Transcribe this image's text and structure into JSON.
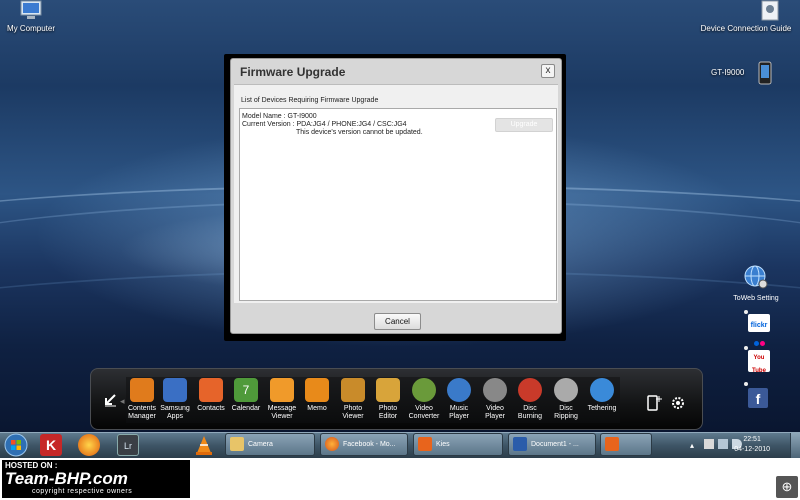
{
  "desktop": {
    "my_computer": "My Computer",
    "device_connection_guide": "Device Connection Guide",
    "device_model": "GT-I9000"
  },
  "dialog": {
    "title": "Firmware Upgrade",
    "close": "x",
    "list_caption": "List of Devices Requiring Firmware Upgrade",
    "model_name": "Model Name : GT-I9000",
    "current_version": "Current Version : PDA:JG4 / PHONE:JG4 / CSC:JG4",
    "status": "This device's version cannot be updated.",
    "upgrade_label": "Upgrade",
    "cancel_label": "Cancel"
  },
  "side_links": {
    "toweb_setting": "ToWeb Setting",
    "flickr_text": "flickr",
    "youtube_text": "You Tube"
  },
  "dock": {
    "items": [
      {
        "line1": "Contents",
        "line2": "Manager",
        "color": "#e07b1c"
      },
      {
        "line1": "Samsung",
        "line2": "Apps",
        "color": "#3a6fc4"
      },
      {
        "line1": "Contacts",
        "line2": "",
        "color": "#e6642a"
      },
      {
        "line1": "Calendar",
        "line2": "",
        "color": "#4f9a3a",
        "badge": "7"
      },
      {
        "line1": "Message",
        "line2": "Viewer",
        "color": "#f09a2a"
      },
      {
        "line1": "Memo",
        "line2": "",
        "color": "#e88a1a"
      },
      {
        "line1": "Photo",
        "line2": "Viewer",
        "color": "#c98b2a"
      },
      {
        "line1": "Photo",
        "line2": "Editor",
        "color": "#d8a43a"
      },
      {
        "line1": "Video",
        "line2": "Converter",
        "color": "#6a9a3a"
      },
      {
        "line1": "Music",
        "line2": "Player",
        "color": "#3a7ac9"
      },
      {
        "line1": "Video",
        "line2": "Player",
        "color": "#888888"
      },
      {
        "line1": "Disc",
        "line2": "Burning",
        "color": "#c93a2a"
      },
      {
        "line1": "Disc",
        "line2": "Ripping",
        "color": "#aaaaaa"
      },
      {
        "line1": "Tethering",
        "line2": "",
        "color": "#3a8ad9"
      }
    ]
  },
  "taskbar": {
    "camera": "Camera",
    "facebook": "Facebook - Mo...",
    "kies": "Kies",
    "document": "Document1 - ...",
    "clock_time": "22:51",
    "clock_date": "04-12-2010"
  },
  "watermark": {
    "hosted_on": "HOSTED ON :",
    "brand": "Team-BHP.com",
    "copyright": "copyright respective owners"
  }
}
